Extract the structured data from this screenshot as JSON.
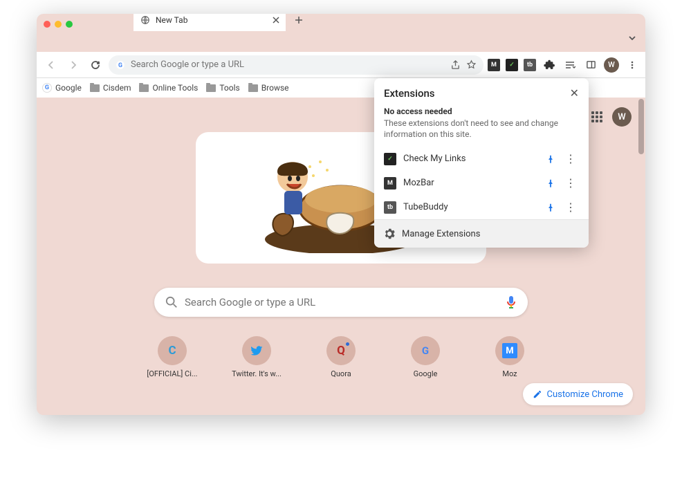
{
  "window": {
    "traffic_colors": [
      "#ff5f57",
      "#febc2e",
      "#28c840"
    ]
  },
  "tab": {
    "title": "New Tab"
  },
  "omnibox": {
    "placeholder": "Search Google or type a URL"
  },
  "avatar_letter": "W",
  "bookmarks": [
    {
      "label": "Google",
      "type": "icon"
    },
    {
      "label": "Cisdem",
      "type": "folder"
    },
    {
      "label": "Online Tools",
      "type": "folder"
    },
    {
      "label": "Tools",
      "type": "folder"
    },
    {
      "label": "Browse",
      "type": "folder"
    }
  ],
  "search": {
    "placeholder": "Search Google or type a URL"
  },
  "shortcuts": [
    {
      "label": "[OFFICIAL] Ci...",
      "icon_letter": "C",
      "icon_bg": "#d8b3a8",
      "icon_color": "#2e9bd6"
    },
    {
      "label": "Twitter. It's w...",
      "icon_letter": "",
      "icon_bg": "#d8b3a8",
      "icon_color": "#1d9bf0",
      "kind": "twitter"
    },
    {
      "label": "Quora",
      "icon_letter": "Q",
      "icon_bg": "#d8b3a8",
      "icon_color": "#b92b27"
    },
    {
      "label": "Google",
      "icon_letter": "G",
      "icon_bg": "#d8b3a8",
      "icon_color": "#4285f4",
      "kind": "google"
    },
    {
      "label": "Moz",
      "icon_letter": "M",
      "icon_bg": "#d8b3a8",
      "icon_color": "#fff",
      "inner_bg": "#2e8bff"
    }
  ],
  "customize_label": "Customize Chrome",
  "extensions_popup": {
    "title": "Extensions",
    "section_title": "No access needed",
    "section_desc": "These extensions don't need to see and change information on this site.",
    "items": [
      {
        "name": "Check My Links",
        "icon_bg": "#222",
        "icon_fg": "#6ac259",
        "abbr": "✓"
      },
      {
        "name": "MozBar",
        "icon_bg": "#333",
        "icon_fg": "#fff",
        "abbr": "M"
      },
      {
        "name": "TubeBuddy",
        "icon_bg": "#555",
        "icon_fg": "#fff",
        "abbr": "tb"
      }
    ],
    "manage_label": "Manage Extensions"
  },
  "toolbar_extensions": [
    {
      "abbr": "M",
      "bg": "#333",
      "fg": "#fff"
    },
    {
      "abbr": "✓",
      "bg": "#222",
      "fg": "#6ac259"
    },
    {
      "abbr": "tb",
      "bg": "#555",
      "fg": "#fff"
    }
  ]
}
